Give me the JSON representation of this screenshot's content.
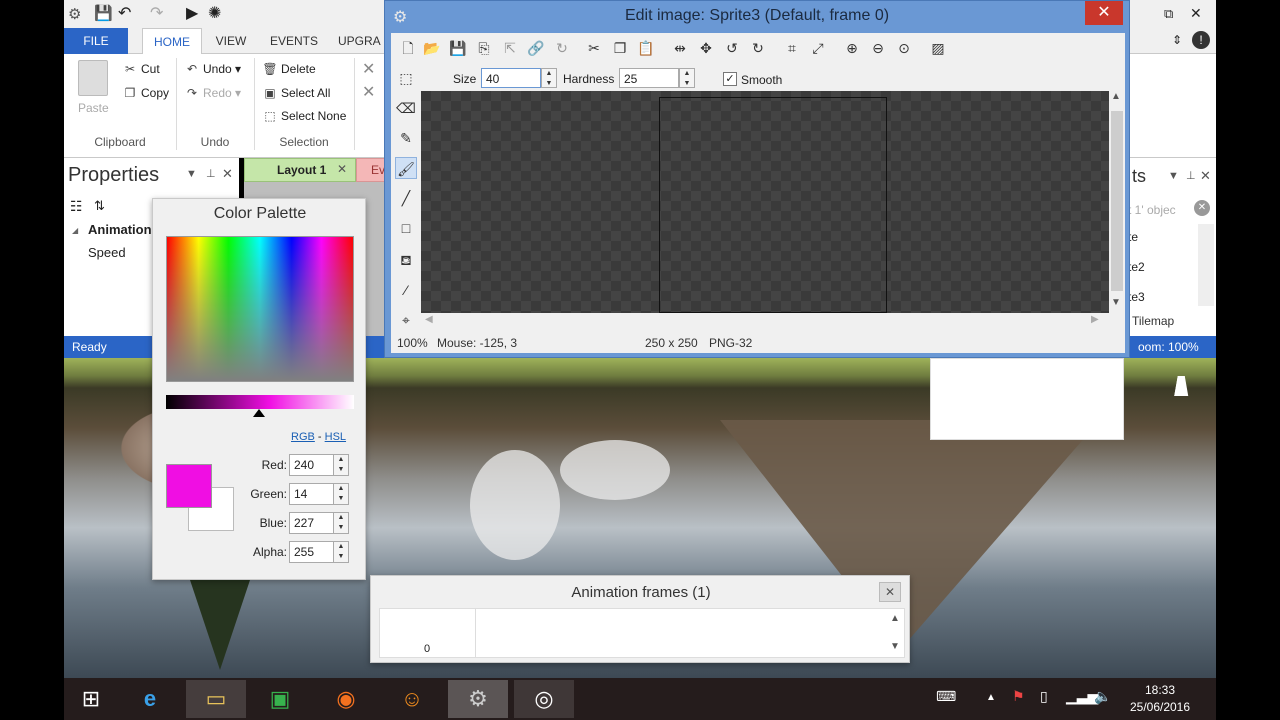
{
  "main": {
    "ribbon_tabs": [
      "FILE",
      "HOME",
      "VIEW",
      "EVENTS",
      "UPGRA"
    ],
    "clipboard": {
      "paste": "Paste",
      "cut": "Cut",
      "copy": "Copy",
      "label": "Clipboard"
    },
    "undo": {
      "undo": "Undo",
      "redo": "Redo",
      "label": "Undo"
    },
    "selection": {
      "delete": "Delete",
      "select_all": "Select All",
      "select_none": "Select None",
      "label": "Selection"
    },
    "properties": {
      "title": "Properties",
      "section": "Animation",
      "row": "Speed"
    },
    "tabs": {
      "layout": "Layout 1",
      "events": "Ev"
    },
    "objects_panel": {
      "title": "ts",
      "search": "t 1' objec",
      "items": [
        "te",
        "te2",
        "te3"
      ],
      "footer": "Tilemap"
    },
    "status": {
      "left": "Ready",
      "right": "oom: 100%"
    }
  },
  "palette": {
    "title": "Color Palette",
    "rgb_link": "RGB",
    "sep": "-",
    "hsl_link": "HSL",
    "fg_color": "#f00ee3",
    "fields": [
      {
        "label": "Red:",
        "value": "240"
      },
      {
        "label": "Green:",
        "value": "14"
      },
      {
        "label": "Blue:",
        "value": "227"
      },
      {
        "label": "Alpha:",
        "value": "255"
      }
    ]
  },
  "editor": {
    "title": "Edit image: Sprite3 (Default, frame 0)",
    "size_label": "Size",
    "size_value": "40",
    "hardness_label": "Hardness",
    "hardness_value": "25",
    "smooth_label": "Smooth",
    "status_zoom": "100%",
    "status_mouse": "Mouse: -125, 3",
    "status_dims": "250 x 250",
    "status_format": "PNG-32"
  },
  "animation": {
    "title": "Animation frames (1)",
    "frame_index": "0"
  },
  "taskbar": {
    "time": "18:33",
    "date": "25/06/2016"
  }
}
